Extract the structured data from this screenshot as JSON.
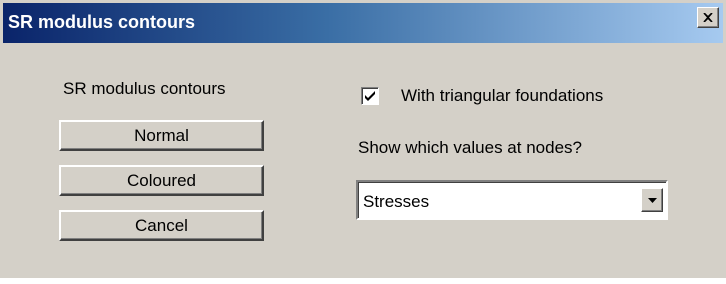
{
  "window": {
    "title": "SR modulus contours",
    "close_glyph": "✕"
  },
  "left_panel": {
    "heading": "SR modulus contours",
    "buttons": {
      "normal": "Normal",
      "coloured": "Coloured",
      "cancel": "Cancel"
    }
  },
  "right_panel": {
    "triangular_foundations": {
      "label": "With triangular foundations",
      "checked": true
    },
    "values_prompt": "Show which values at nodes?",
    "values_select": {
      "selected": "Stresses"
    }
  },
  "icons": {
    "close": "close-icon",
    "checkmark": "checkmark-icon",
    "dropdown": "chevron-down-icon"
  },
  "colors": {
    "dialog_face": "#d4d0c8",
    "title_gradient_start": "#0a246a",
    "title_gradient_end": "#a6caf0",
    "title_text": "#ffffff"
  }
}
